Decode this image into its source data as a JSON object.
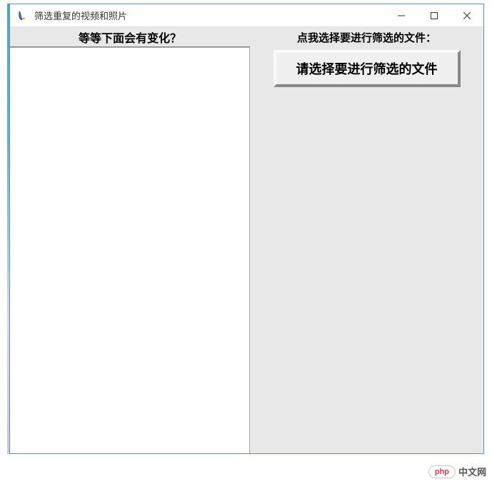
{
  "window": {
    "title": "筛选重复的视频和照片"
  },
  "left": {
    "header": "等等下面会有变化？"
  },
  "right": {
    "header": "点我选择要进行筛选的文件：",
    "button_label": "请选择要进行筛选的文件"
  },
  "watermark": {
    "badge": "php",
    "text": "中文网"
  }
}
